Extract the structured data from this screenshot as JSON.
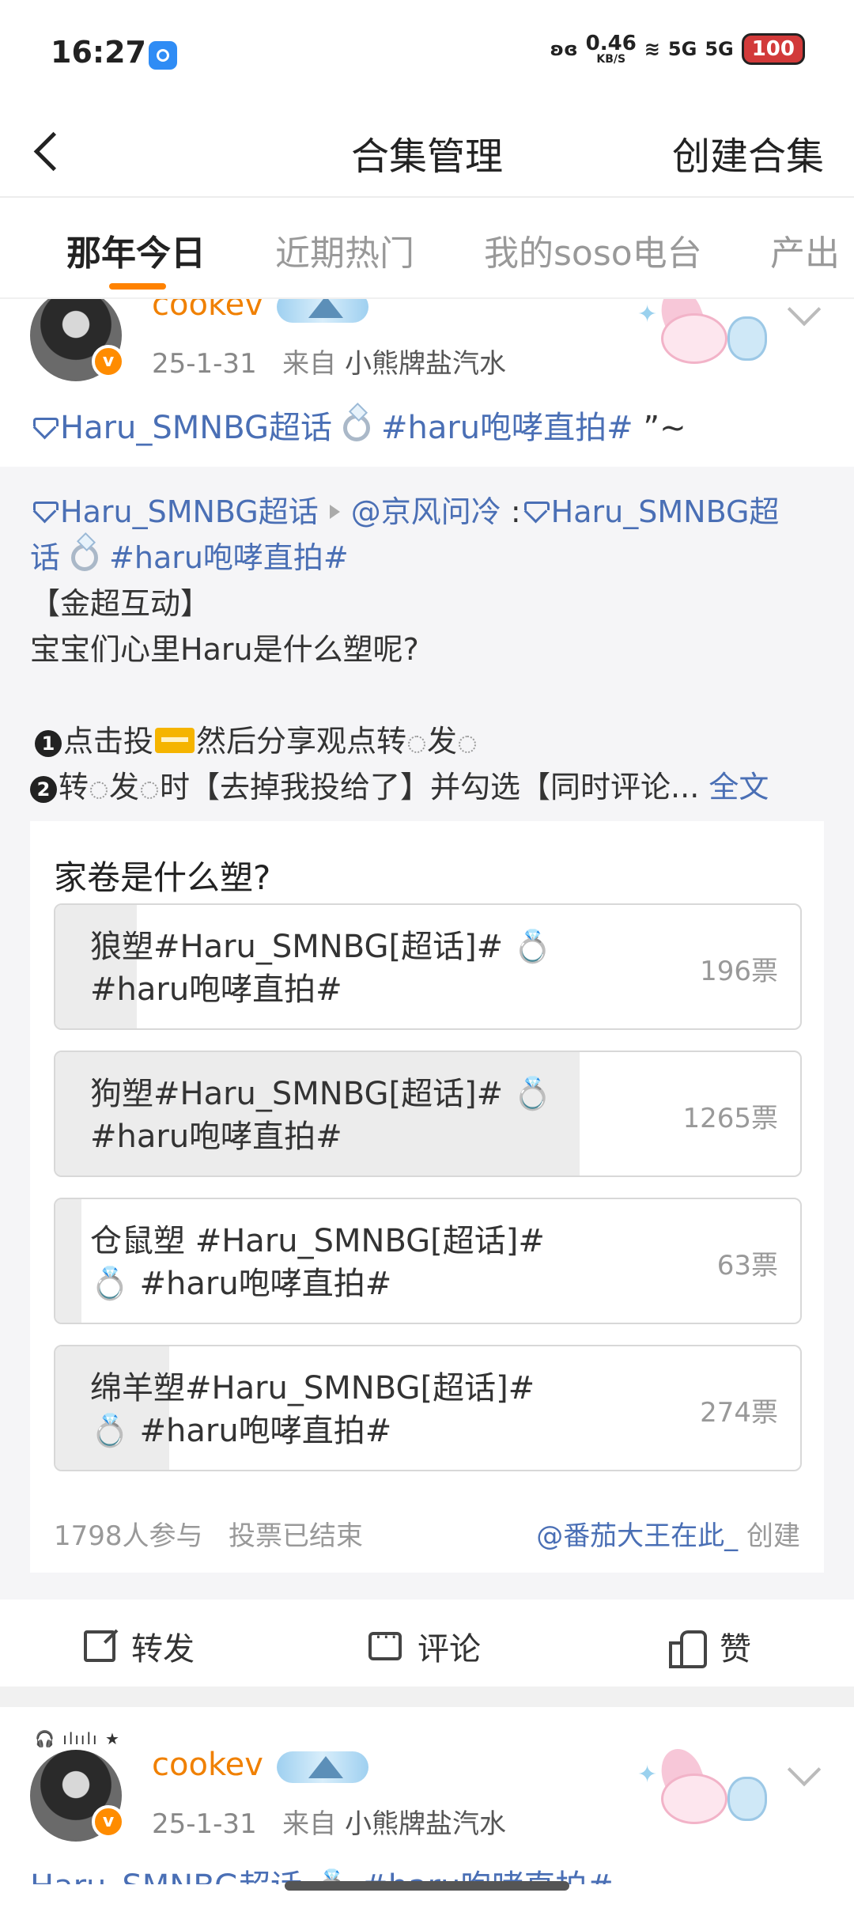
{
  "status_bar": {
    "time": "16:27",
    "net_speed": "0.46",
    "net_unit": "KB/S",
    "signal_1": "5G",
    "signal_2": "5G",
    "battery": "100"
  },
  "nav": {
    "title": "合集管理",
    "action_label": "创建合集",
    "back_icon": "chevron-left-icon"
  },
  "tabs": [
    {
      "label": "那年今日",
      "active": true
    },
    {
      "label": "近期热门",
      "active": false
    },
    {
      "label": "我的soso电台",
      "active": false
    },
    {
      "label": "产出",
      "active": false
    }
  ],
  "post1": {
    "username": "cookev",
    "date": "25-1-31",
    "from_prefix": "来自",
    "source": "小熊牌盐汽水",
    "topic": "Haru_SMNBG超话",
    "hashtag": "#haru咆哮直拍#",
    "tail": "”~",
    "repost": {
      "topic": "Haru_SMNBG超话",
      "mention": "@京风问冷",
      "colon": ":",
      "topic2_part1": "Haru_SMNBG超",
      "topic2_part2": "话",
      "hashtag": "#haru咆哮直拍#",
      "line3": "【金超互动】",
      "line4": "宝宝们心里Haru是什么塑呢?",
      "step1_num": "1",
      "step1_a": "点击投",
      "step1_b": "然后分享观点转",
      "step1_c": "发",
      "step2_num": "2",
      "step2_a": "转",
      "step2_b": "发",
      "step2_c": "时【去掉我投给了】并勾选【同时评论...",
      "full_text": "全文",
      "poll": {
        "question": "家卷是什么塑?",
        "options": [
          {
            "label": "狼塑#Haru_SMNBG[超话]# 💍\n#haru咆哮直拍#",
            "votes": 196,
            "votes_text": "196票"
          },
          {
            "label": "狗塑#Haru_SMNBG[超话]# 💍\n#haru咆哮直拍#",
            "votes": 1265,
            "votes_text": "1265票"
          },
          {
            "label": "仓鼠塑 #Haru_SMNBG[超话]#\n💍 #haru咆哮直拍#",
            "votes": 63,
            "votes_text": "63票"
          },
          {
            "label": "绵羊塑#Haru_SMNBG[超话]#\n💍 #haru咆哮直拍#",
            "votes": 274,
            "votes_text": "274票"
          }
        ],
        "participants": "1798人参与",
        "status": "投票已结束",
        "creator": "@番茄大王在此_",
        "creator_suffix": "创建"
      }
    },
    "actions": {
      "share": "转发",
      "comment": "评论",
      "like": "赞"
    }
  },
  "post2": {
    "username": "cookev",
    "date": "25-1-31",
    "from_prefix": "来自",
    "source": "小熊牌盐汽水",
    "partial_text": "Haru_SMNBG超话 💍 #haru咆哮直拍#"
  },
  "colors": {
    "accent": "#ff8200",
    "link": "#4a6fb5",
    "username": "#f08000"
  }
}
